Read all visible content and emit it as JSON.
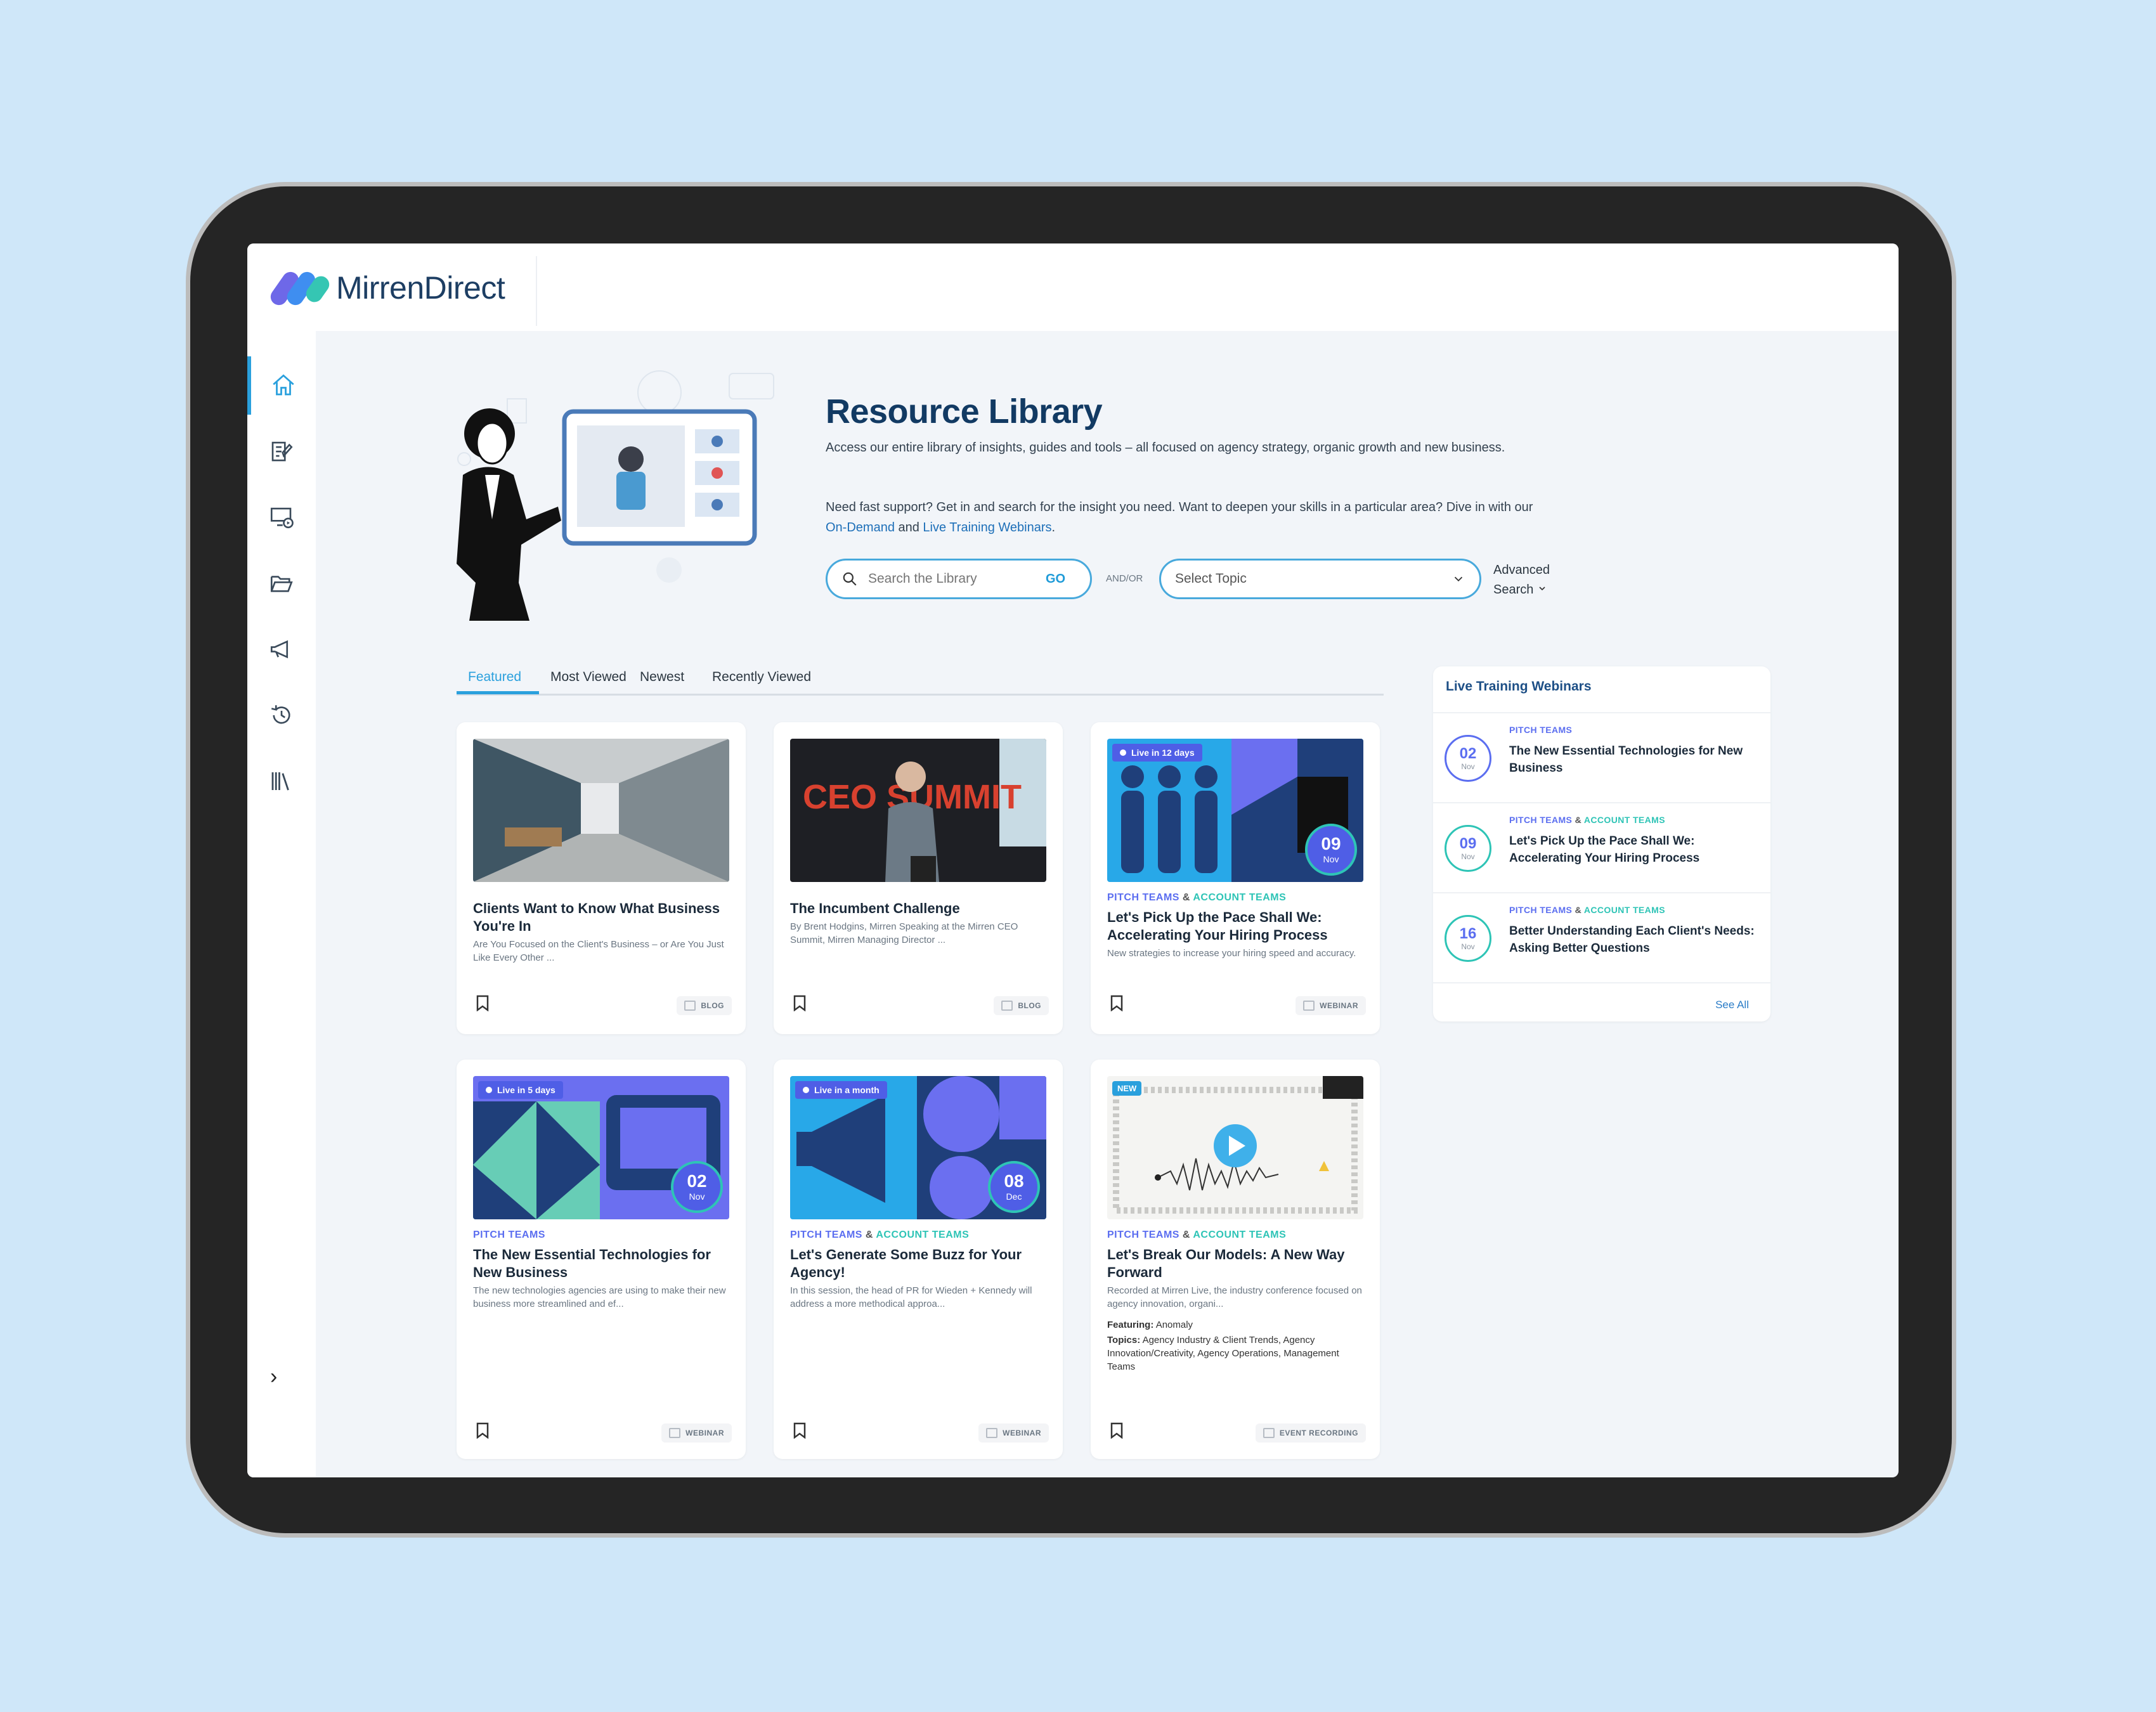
{
  "app": {
    "brand": "MirrenDirect"
  },
  "colors": {
    "background": "#cfe7f9",
    "primary": "#123a63",
    "accent": "#2aa0dd",
    "pitch": "#5b6ef0",
    "account": "#2ec4b6"
  },
  "sidebar": {
    "items": [
      {
        "icon": "home-icon",
        "active": true
      },
      {
        "icon": "edit-document-icon"
      },
      {
        "icon": "video-screen-icon"
      },
      {
        "icon": "folder-open-icon"
      },
      {
        "icon": "megaphone-icon"
      },
      {
        "icon": "history-icon"
      },
      {
        "icon": "library-books-icon"
      }
    ],
    "expand_icon": "chevron-right-icon"
  },
  "hero": {
    "title": "Resource Library",
    "description": "Access our entire library of insights, guides and tools – all focused on agency strategy, organic growth and new business.",
    "support_text": "Need fast support? Get in and search for the insight you need. Want to deepen your skills in a particular area? Dive in with our ",
    "support_link1": "On-Demand",
    "support_and": " and ",
    "support_link2": "Live Training Webinars",
    "support_end": "."
  },
  "search": {
    "placeholder": "Search the Library",
    "go_label": "GO",
    "andor": "AND/OR",
    "topic_placeholder": "Select Topic",
    "advanced_line1": "Advanced",
    "advanced_line2": "Search"
  },
  "tabs": [
    {
      "label": "Featured",
      "active": true
    },
    {
      "label": "Most Viewed"
    },
    {
      "label": "Newest"
    },
    {
      "label": "Recently Viewed"
    }
  ],
  "cards": [
    {
      "title": "Clients Want to Know What Business You're In",
      "excerpt": "Are You Focused on the Client's Business – or Are You Just Like Every Other ...",
      "type": "BLOG"
    },
    {
      "title": "The Incumbent Challenge",
      "excerpt": "By Brent Hodgins, Mirren Speaking at the Mirren CEO Summit, Mirren Managing Director ...",
      "type": "BLOG",
      "thumb_text": "CEO SUMMIT"
    },
    {
      "live": "Live in 12 days",
      "date_day": "09",
      "date_month": "Nov",
      "tag_pitch": "PITCH TEAMS",
      "tag_amp": "&",
      "tag_account": "ACCOUNT TEAMS",
      "title": "Let's Pick Up the Pace Shall We: Accelerating Your Hiring Process",
      "excerpt": "New strategies to increase your hiring speed and accuracy.",
      "type": "WEBINAR"
    },
    {
      "live": "Live in 5 days",
      "date_day": "02",
      "date_month": "Nov",
      "tag_pitch": "PITCH TEAMS",
      "title": "The New Essential Technologies for New Business",
      "excerpt": "The new technologies agencies are using to make their new business more streamlined and ef...",
      "type": "WEBINAR"
    },
    {
      "live": "Live in a month",
      "date_day": "08",
      "date_month": "Dec",
      "tag_pitch": "PITCH TEAMS",
      "tag_amp": "&",
      "tag_account": "ACCOUNT TEAMS",
      "title": "Let's Generate Some Buzz for Your Agency!",
      "excerpt": "In this session, the head of PR for Wieden + Kennedy will address a more methodical approa...",
      "type": "WEBINAR"
    },
    {
      "badge": "NEW",
      "tag_pitch": "PITCH TEAMS",
      "tag_amp": "&",
      "tag_account": "ACCOUNT TEAMS",
      "title": "Let's Break Our Models: A New Way Forward",
      "excerpt": "Recorded at Mirren Live, the industry conference focused on agency innovation, organi...",
      "featuring_label": "Featuring:",
      "featuring": "Anomaly",
      "topics_label": "Topics:",
      "topics": "Agency Industry & Client Trends, Agency Innovation/Creativity, Agency Operations, Management Teams",
      "type": "EVENT RECORDING"
    }
  ],
  "webinars": {
    "title": "Live Training Webinars",
    "items": [
      {
        "day": "02",
        "month": "Nov",
        "tag_pitch": "PITCH TEAMS",
        "title": "The New Essential Technologies for New Business"
      },
      {
        "day": "09",
        "month": "Nov",
        "tag_pitch": "PITCH TEAMS",
        "tag_amp": "&",
        "tag_account": "ACCOUNT TEAMS",
        "title": "Let's Pick Up the Pace Shall We: Accelerating Your Hiring Process"
      },
      {
        "day": "16",
        "month": "Nov",
        "tag_pitch": "PITCH TEAMS",
        "tag_amp": "&",
        "tag_account": "ACCOUNT TEAMS",
        "title": "Better Understanding Each Client's Needs: Asking Better Questions"
      }
    ],
    "see_all": "See All"
  }
}
